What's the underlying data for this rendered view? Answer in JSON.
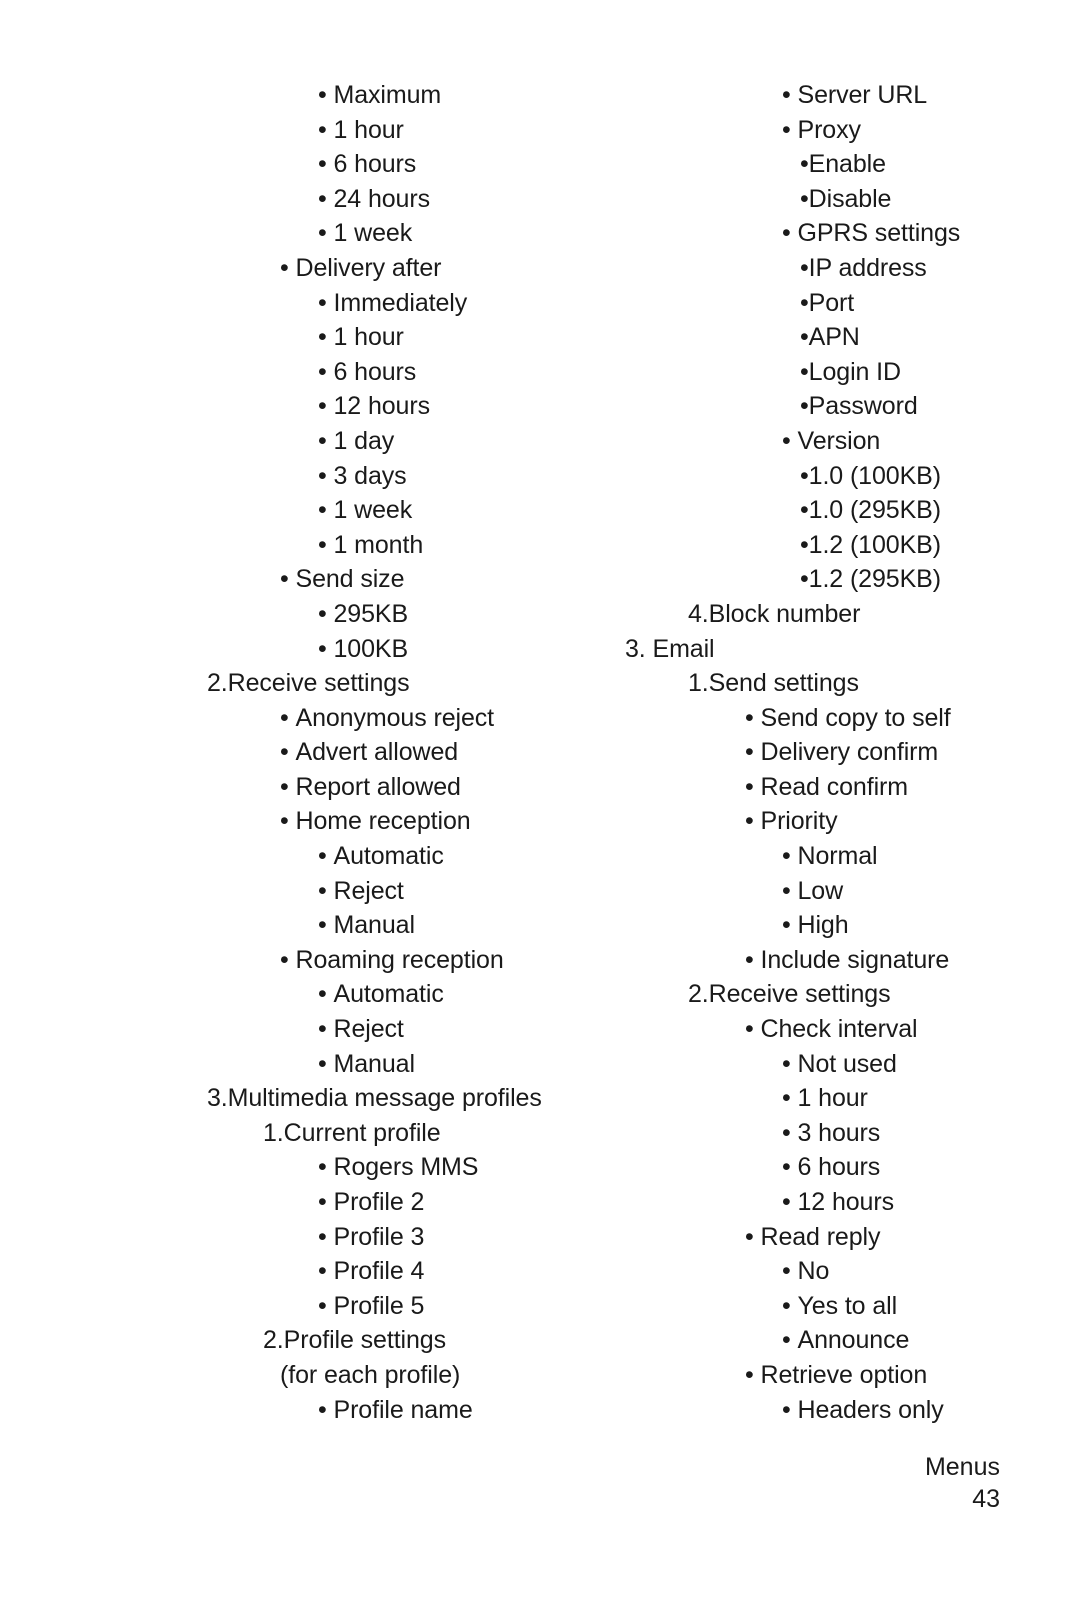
{
  "page": {
    "footer_section": "Menus",
    "page_number": "43"
  },
  "outline": {
    "left_column": [
      {
        "text": "Maximum",
        "level": 3,
        "marker": "bullet-wide"
      },
      {
        "text": "1 hour",
        "level": 3,
        "marker": "bullet-wide"
      },
      {
        "text": "6 hours",
        "level": 3,
        "marker": "bullet-wide"
      },
      {
        "text": "24 hours",
        "level": 3,
        "marker": "bullet-wide"
      },
      {
        "text": "1 week",
        "level": 3,
        "marker": "bullet-wide"
      },
      {
        "text": "Delivery after",
        "level": 2,
        "marker": "bullet-wide"
      },
      {
        "text": "Immediately",
        "level": 3,
        "marker": "bullet-wide"
      },
      {
        "text": "1 hour",
        "level": 3,
        "marker": "bullet-wide"
      },
      {
        "text": "6 hours",
        "level": 3,
        "marker": "bullet-wide"
      },
      {
        "text": "12 hours",
        "level": 3,
        "marker": "bullet-wide"
      },
      {
        "text": "1 day",
        "level": 3,
        "marker": "bullet-wide"
      },
      {
        "text": "3 days",
        "level": 3,
        "marker": "bullet-wide"
      },
      {
        "text": "1 week",
        "level": 3,
        "marker": "bullet-wide"
      },
      {
        "text": "1 month",
        "level": 3,
        "marker": "bullet-wide"
      },
      {
        "text": "Send size",
        "level": 2,
        "marker": "bullet-wide"
      },
      {
        "text": "295KB",
        "level": 3,
        "marker": "bullet-wide"
      },
      {
        "text": "100KB",
        "level": 3,
        "marker": "bullet-wide"
      },
      {
        "text": "2.Receive settings",
        "level": 0,
        "marker": "none"
      },
      {
        "text": "Anonymous reject",
        "level": 2,
        "marker": "bullet-wide"
      },
      {
        "text": "Advert allowed",
        "level": 2,
        "marker": "bullet-wide"
      },
      {
        "text": "Report allowed",
        "level": 2,
        "marker": "bullet-wide"
      },
      {
        "text": "Home reception",
        "level": 2,
        "marker": "bullet-wide"
      },
      {
        "text": "Automatic",
        "level": 3,
        "marker": "bullet-wide"
      },
      {
        "text": "Reject",
        "level": 3,
        "marker": "bullet-wide"
      },
      {
        "text": "Manual",
        "level": 3,
        "marker": "bullet-wide"
      },
      {
        "text": "Roaming reception",
        "level": 2,
        "marker": "bullet-wide"
      },
      {
        "text": "Automatic",
        "level": 3,
        "marker": "bullet-wide"
      },
      {
        "text": "Reject",
        "level": 3,
        "marker": "bullet-wide"
      },
      {
        "text": "Manual",
        "level": 3,
        "marker": "bullet-wide"
      },
      {
        "text": "3.Multimedia message profiles",
        "level": 0,
        "marker": "none"
      },
      {
        "text": "1.Current profile",
        "level": 1,
        "marker": "none"
      },
      {
        "text": "Rogers MMS",
        "level": 3,
        "marker": "bullet-wide"
      },
      {
        "text": "Profile 2",
        "level": 3,
        "marker": "bullet-wide"
      },
      {
        "text": "Profile 3",
        "level": 3,
        "marker": "bullet-wide"
      },
      {
        "text": "Profile 4",
        "level": 3,
        "marker": "bullet-wide"
      },
      {
        "text": "Profile 5",
        "level": 3,
        "marker": "bullet-wide"
      },
      {
        "text": "2.Profile settings",
        "level": 1,
        "marker": "none"
      },
      {
        "text": "(for each profile)",
        "level": 2,
        "marker": "none"
      },
      {
        "text": "Profile name",
        "level": 3,
        "marker": "bullet-wide"
      }
    ],
    "right_column": [
      {
        "text": "Server URL",
        "level": 3,
        "marker": "bullet-wide"
      },
      {
        "text": "Proxy",
        "level": 3,
        "marker": "bullet-wide"
      },
      {
        "text": "Enable",
        "level": 4,
        "marker": "bullet-tight"
      },
      {
        "text": "Disable",
        "level": 4,
        "marker": "bullet-tight"
      },
      {
        "text": "GPRS settings",
        "level": 3,
        "marker": "bullet-wide"
      },
      {
        "text": "IP address",
        "level": 4,
        "marker": "bullet-tight"
      },
      {
        "text": "Port",
        "level": 4,
        "marker": "bullet-tight"
      },
      {
        "text": "APN",
        "level": 4,
        "marker": "bullet-tight"
      },
      {
        "text": "Login ID",
        "level": 4,
        "marker": "bullet-tight"
      },
      {
        "text": "Password",
        "level": 4,
        "marker": "bullet-tight"
      },
      {
        "text": "Version",
        "level": 3,
        "marker": "bullet-wide"
      },
      {
        "text": "1.0 (100KB)",
        "level": 4,
        "marker": "bullet-tight"
      },
      {
        "text": "1.0 (295KB)",
        "level": 4,
        "marker": "bullet-tight"
      },
      {
        "text": "1.2 (100KB)",
        "level": 4,
        "marker": "bullet-tight"
      },
      {
        "text": "1.2 (295KB)",
        "level": 4,
        "marker": "bullet-tight"
      },
      {
        "text": "4.Block number",
        "level": 1,
        "marker": "none"
      },
      {
        "text": "3. Email",
        "level": 0,
        "marker": "none"
      },
      {
        "text": "1.Send settings",
        "level": 1,
        "marker": "none"
      },
      {
        "text": "Send copy to self",
        "level": 2,
        "marker": "bullet-wide"
      },
      {
        "text": "Delivery confirm",
        "level": 2,
        "marker": "bullet-wide"
      },
      {
        "text": "Read confirm",
        "level": 2,
        "marker": "bullet-wide"
      },
      {
        "text": "Priority",
        "level": 2,
        "marker": "bullet-wide"
      },
      {
        "text": "Normal",
        "level": 3,
        "marker": "bullet-wide"
      },
      {
        "text": "Low",
        "level": 3,
        "marker": "bullet-wide"
      },
      {
        "text": "High",
        "level": 3,
        "marker": "bullet-wide"
      },
      {
        "text": "Include signature",
        "level": 2,
        "marker": "bullet-wide"
      },
      {
        "text": "2.Receive settings",
        "level": 1,
        "marker": "none"
      },
      {
        "text": "Check interval",
        "level": 2,
        "marker": "bullet-wide"
      },
      {
        "text": "Not used",
        "level": 3,
        "marker": "bullet-wide"
      },
      {
        "text": "1 hour",
        "level": 3,
        "marker": "bullet-wide"
      },
      {
        "text": "3 hours",
        "level": 3,
        "marker": "bullet-wide"
      },
      {
        "text": "6 hours",
        "level": 3,
        "marker": "bullet-wide"
      },
      {
        "text": "12 hours",
        "level": 3,
        "marker": "bullet-wide"
      },
      {
        "text": "Read reply",
        "level": 2,
        "marker": "bullet-wide"
      },
      {
        "text": "No",
        "level": 3,
        "marker": "bullet-wide"
      },
      {
        "text": "Yes to all",
        "level": 3,
        "marker": "bullet-wide"
      },
      {
        "text": "Announce",
        "level": 3,
        "marker": "bullet-wide"
      },
      {
        "text": "Retrieve option",
        "level": 2,
        "marker": "bullet-wide"
      },
      {
        "text": "Headers only",
        "level": 3,
        "marker": "bullet-wide"
      }
    ]
  }
}
